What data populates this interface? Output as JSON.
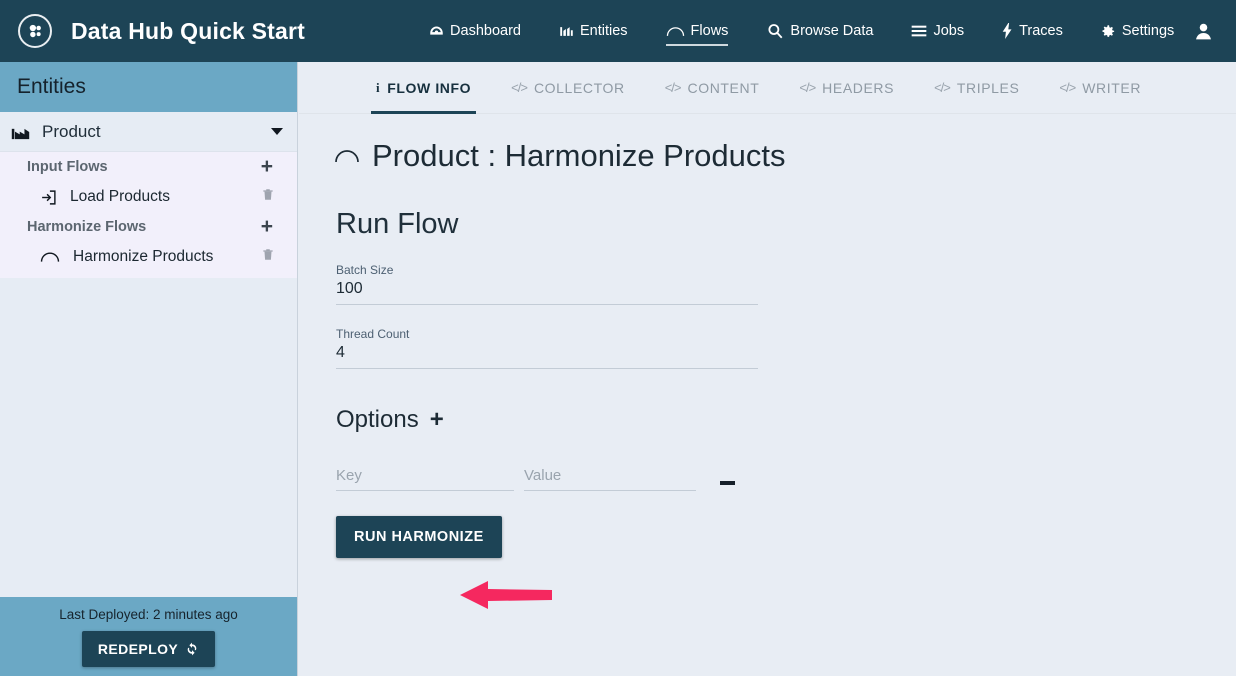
{
  "navbar": {
    "logo_icon": "molecule-logo-icon",
    "app_title": "Data Hub Quick Start",
    "links": [
      {
        "label": "Dashboard",
        "icon": "dashboard-icon",
        "active": false
      },
      {
        "label": "Entities",
        "icon": "entities-bar-icon",
        "active": false
      },
      {
        "label": "Flows",
        "icon": "flows-arc-icon",
        "active": true
      },
      {
        "label": "Browse Data",
        "icon": "search-icon",
        "active": false
      },
      {
        "label": "Jobs",
        "icon": "jobs-list-icon",
        "active": false
      },
      {
        "label": "Traces",
        "icon": "bolt-icon",
        "active": false
      },
      {
        "label": "Settings",
        "icon": "gear-icon",
        "active": false
      }
    ],
    "avatar_icon": "user-avatar-icon"
  },
  "sidebar": {
    "title": "Entities",
    "entity": {
      "name": "Product",
      "icon": "factory-icon",
      "caret": "chevron-down-icon"
    },
    "groups": [
      {
        "label": "Input Flows",
        "add_label": "+",
        "items": [
          {
            "label": "Load Products",
            "icon": "sign-in-icon",
            "delete_icon": "trash-icon"
          }
        ]
      },
      {
        "label": "Harmonize Flows",
        "add_label": "+",
        "items": [
          {
            "label": "Harmonize Products",
            "icon": "arc-icon",
            "delete_icon": "trash-icon"
          }
        ]
      }
    ],
    "footer": {
      "last_deployed": "Last Deployed: 2 minutes ago",
      "redeploy_label": "REDEPLOY",
      "redeploy_icon": "refresh-icon"
    }
  },
  "main": {
    "tabs": [
      {
        "label": "FLOW INFO",
        "icon": "info-icon",
        "active": true
      },
      {
        "label": "COLLECTOR",
        "icon": "code-icon",
        "active": false
      },
      {
        "label": "CONTENT",
        "icon": "code-icon",
        "active": false
      },
      {
        "label": "HEADERS",
        "icon": "code-icon",
        "active": false
      },
      {
        "label": "TRIPLES",
        "icon": "code-icon",
        "active": false
      },
      {
        "label": "WRITER",
        "icon": "code-icon",
        "active": false
      }
    ],
    "page_title": "Product : Harmonize Products",
    "page_title_icon": "arc-icon",
    "run_flow_heading": "Run Flow",
    "fields": [
      {
        "label": "Batch Size",
        "value": "100"
      },
      {
        "label": "Thread Count",
        "value": "4"
      }
    ],
    "options": {
      "heading": "Options",
      "add_label": "+",
      "key_placeholder": "Key",
      "key_value": "",
      "value_placeholder": "Value",
      "value_value": "",
      "remove_icon": "minus-icon"
    },
    "run_button_label": "RUN HARMONIZE"
  },
  "annotation": {
    "arrow_icon": "pointer-arrow-icon",
    "arrow_color": "#f5285f",
    "points_at": "RUN HARMONIZE"
  },
  "colors": {
    "navbar_bg": "#1d4456",
    "sidebar_header_bg": "#6ba8c5",
    "sidebar_body_bg": "#e6ecf4",
    "flows_list_bg": "#f2f0fb",
    "main_bg": "#e8edf4",
    "button_bg": "#1d4456",
    "accent_arrow": "#f5285f"
  }
}
